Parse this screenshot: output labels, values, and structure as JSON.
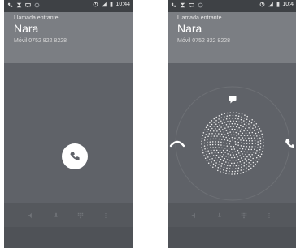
{
  "screens": [
    {
      "id": "left",
      "statusbar": {
        "icons": [
          "phone-icon",
          "missed-call-icon",
          "message-icon",
          "alarm-icon"
        ],
        "right_icons": [
          "sync-icon",
          "signal-icon",
          "battery-icon"
        ],
        "time": "10:44"
      },
      "header": {
        "incoming_label": "Llamada entrante",
        "caller_name": "Nara",
        "caller_number": "Móvil 0752 822 8228"
      },
      "bottombar": {
        "icons": [
          "speaker-icon",
          "mute-icon",
          "dialpad-icon",
          "more-icon"
        ]
      }
    },
    {
      "id": "right",
      "statusbar": {
        "icons": [
          "phone-icon",
          "missed-call-icon",
          "message-icon",
          "alarm-icon"
        ],
        "right_icons": [
          "sync-icon",
          "signal-icon",
          "battery-icon"
        ],
        "time": "10:4"
      },
      "header": {
        "incoming_label": "Llamada entrante",
        "caller_name": "Nara",
        "caller_number": "Móvil 0752 822 8228"
      },
      "bottombar": {
        "icons": [
          "speaker-icon",
          "mute-icon",
          "dialpad-icon",
          "more-icon"
        ]
      }
    }
  ],
  "colors": {
    "header": "#7b7e83",
    "call_area": "#5f6268",
    "statusbar": "#3e4145",
    "answer": "#ffffff"
  }
}
